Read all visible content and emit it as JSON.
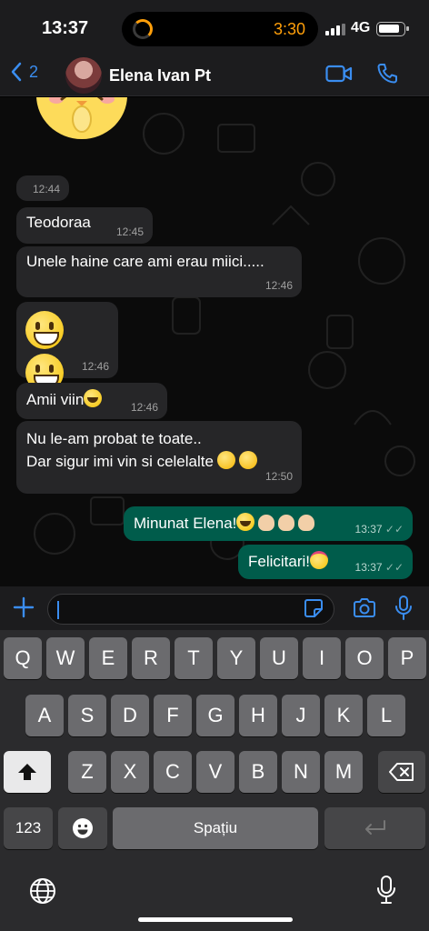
{
  "status_bar": {
    "time": "13:37",
    "timer": "3:30",
    "network": "4G"
  },
  "header": {
    "back_count": "2",
    "contact_name": "Elena Ivan Pt"
  },
  "messages": [
    {
      "direction": "in",
      "text": "",
      "time": "12:44"
    },
    {
      "direction": "in",
      "text": "Teodoraa",
      "time": "12:45"
    },
    {
      "direction": "in",
      "text": "Unele haine care ami erau miici.....",
      "time": "12:46"
    },
    {
      "direction": "in",
      "text": "",
      "time": "12:46"
    },
    {
      "direction": "in",
      "text": "Amii viin",
      "time": "12:46"
    },
    {
      "direction": "in",
      "line1": "Nu le-am probat te toate..",
      "line2": "Dar sigur imi vin si celelalte",
      "time": "12:50"
    },
    {
      "direction": "out",
      "text": "Minunat Elena!",
      "time": "13:37"
    },
    {
      "direction": "out",
      "text": "Felicitari!",
      "time": "13:37"
    }
  ],
  "keyboard": {
    "row1": [
      "Q",
      "W",
      "E",
      "R",
      "T",
      "Y",
      "U",
      "I",
      "O",
      "P"
    ],
    "row2": [
      "A",
      "S",
      "D",
      "F",
      "G",
      "H",
      "J",
      "K",
      "L"
    ],
    "row3": [
      "Z",
      "X",
      "C",
      "V",
      "B",
      "N",
      "M"
    ],
    "numbers_label": "123",
    "space_label": "Spațiu"
  },
  "icons": {
    "back": "chevron-left-icon",
    "video": "video-camera-icon",
    "call": "phone-icon",
    "plus": "plus-icon",
    "sticker": "sticker-icon",
    "camera": "camera-icon",
    "mic": "microphone-icon",
    "shift": "shift-arrow-icon",
    "delete": "backspace-icon",
    "emoji": "emoji-icon",
    "return": "return-icon",
    "globe": "globe-icon"
  },
  "colors": {
    "accent": "#3a8df0",
    "outgoing_bubble": "#005c4b",
    "incoming_bubble": "#262628",
    "timer": "#ff9f0a"
  }
}
